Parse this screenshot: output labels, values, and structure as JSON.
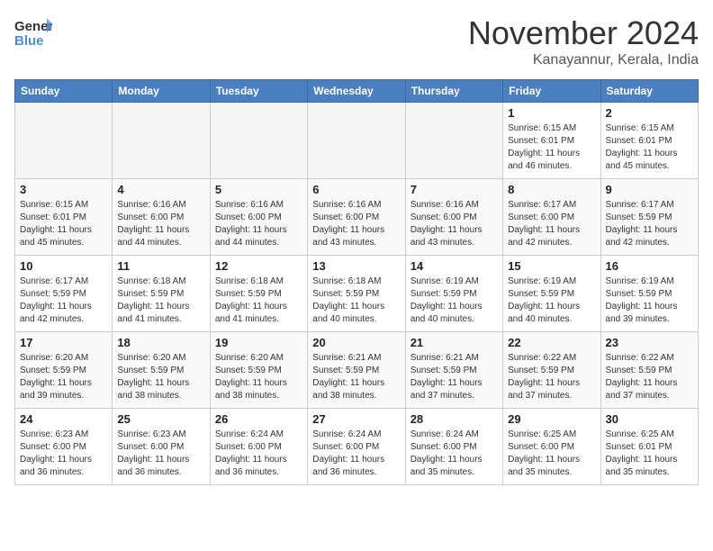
{
  "header": {
    "logo_line1": "General",
    "logo_line2": "Blue",
    "month_year": "November 2024",
    "location": "Kanayannur, Kerala, India"
  },
  "weekdays": [
    "Sunday",
    "Monday",
    "Tuesday",
    "Wednesday",
    "Thursday",
    "Friday",
    "Saturday"
  ],
  "weeks": [
    [
      {
        "day": "",
        "info": ""
      },
      {
        "day": "",
        "info": ""
      },
      {
        "day": "",
        "info": ""
      },
      {
        "day": "",
        "info": ""
      },
      {
        "day": "",
        "info": ""
      },
      {
        "day": "1",
        "info": "Sunrise: 6:15 AM\nSunset: 6:01 PM\nDaylight: 11 hours\nand 46 minutes."
      },
      {
        "day": "2",
        "info": "Sunrise: 6:15 AM\nSunset: 6:01 PM\nDaylight: 11 hours\nand 45 minutes."
      }
    ],
    [
      {
        "day": "3",
        "info": "Sunrise: 6:15 AM\nSunset: 6:01 PM\nDaylight: 11 hours\nand 45 minutes."
      },
      {
        "day": "4",
        "info": "Sunrise: 6:16 AM\nSunset: 6:00 PM\nDaylight: 11 hours\nand 44 minutes."
      },
      {
        "day": "5",
        "info": "Sunrise: 6:16 AM\nSunset: 6:00 PM\nDaylight: 11 hours\nand 44 minutes."
      },
      {
        "day": "6",
        "info": "Sunrise: 6:16 AM\nSunset: 6:00 PM\nDaylight: 11 hours\nand 43 minutes."
      },
      {
        "day": "7",
        "info": "Sunrise: 6:16 AM\nSunset: 6:00 PM\nDaylight: 11 hours\nand 43 minutes."
      },
      {
        "day": "8",
        "info": "Sunrise: 6:17 AM\nSunset: 6:00 PM\nDaylight: 11 hours\nand 42 minutes."
      },
      {
        "day": "9",
        "info": "Sunrise: 6:17 AM\nSunset: 5:59 PM\nDaylight: 11 hours\nand 42 minutes."
      }
    ],
    [
      {
        "day": "10",
        "info": "Sunrise: 6:17 AM\nSunset: 5:59 PM\nDaylight: 11 hours\nand 42 minutes."
      },
      {
        "day": "11",
        "info": "Sunrise: 6:18 AM\nSunset: 5:59 PM\nDaylight: 11 hours\nand 41 minutes."
      },
      {
        "day": "12",
        "info": "Sunrise: 6:18 AM\nSunset: 5:59 PM\nDaylight: 11 hours\nand 41 minutes."
      },
      {
        "day": "13",
        "info": "Sunrise: 6:18 AM\nSunset: 5:59 PM\nDaylight: 11 hours\nand 40 minutes."
      },
      {
        "day": "14",
        "info": "Sunrise: 6:19 AM\nSunset: 5:59 PM\nDaylight: 11 hours\nand 40 minutes."
      },
      {
        "day": "15",
        "info": "Sunrise: 6:19 AM\nSunset: 5:59 PM\nDaylight: 11 hours\nand 40 minutes."
      },
      {
        "day": "16",
        "info": "Sunrise: 6:19 AM\nSunset: 5:59 PM\nDaylight: 11 hours\nand 39 minutes."
      }
    ],
    [
      {
        "day": "17",
        "info": "Sunrise: 6:20 AM\nSunset: 5:59 PM\nDaylight: 11 hours\nand 39 minutes."
      },
      {
        "day": "18",
        "info": "Sunrise: 6:20 AM\nSunset: 5:59 PM\nDaylight: 11 hours\nand 38 minutes."
      },
      {
        "day": "19",
        "info": "Sunrise: 6:20 AM\nSunset: 5:59 PM\nDaylight: 11 hours\nand 38 minutes."
      },
      {
        "day": "20",
        "info": "Sunrise: 6:21 AM\nSunset: 5:59 PM\nDaylight: 11 hours\nand 38 minutes."
      },
      {
        "day": "21",
        "info": "Sunrise: 6:21 AM\nSunset: 5:59 PM\nDaylight: 11 hours\nand 37 minutes."
      },
      {
        "day": "22",
        "info": "Sunrise: 6:22 AM\nSunset: 5:59 PM\nDaylight: 11 hours\nand 37 minutes."
      },
      {
        "day": "23",
        "info": "Sunrise: 6:22 AM\nSunset: 5:59 PM\nDaylight: 11 hours\nand 37 minutes."
      }
    ],
    [
      {
        "day": "24",
        "info": "Sunrise: 6:23 AM\nSunset: 6:00 PM\nDaylight: 11 hours\nand 36 minutes."
      },
      {
        "day": "25",
        "info": "Sunrise: 6:23 AM\nSunset: 6:00 PM\nDaylight: 11 hours\nand 36 minutes."
      },
      {
        "day": "26",
        "info": "Sunrise: 6:24 AM\nSunset: 6:00 PM\nDaylight: 11 hours\nand 36 minutes."
      },
      {
        "day": "27",
        "info": "Sunrise: 6:24 AM\nSunset: 6:00 PM\nDaylight: 11 hours\nand 36 minutes."
      },
      {
        "day": "28",
        "info": "Sunrise: 6:24 AM\nSunset: 6:00 PM\nDaylight: 11 hours\nand 35 minutes."
      },
      {
        "day": "29",
        "info": "Sunrise: 6:25 AM\nSunset: 6:00 PM\nDaylight: 11 hours\nand 35 minutes."
      },
      {
        "day": "30",
        "info": "Sunrise: 6:25 AM\nSunset: 6:01 PM\nDaylight: 11 hours\nand 35 minutes."
      }
    ]
  ]
}
